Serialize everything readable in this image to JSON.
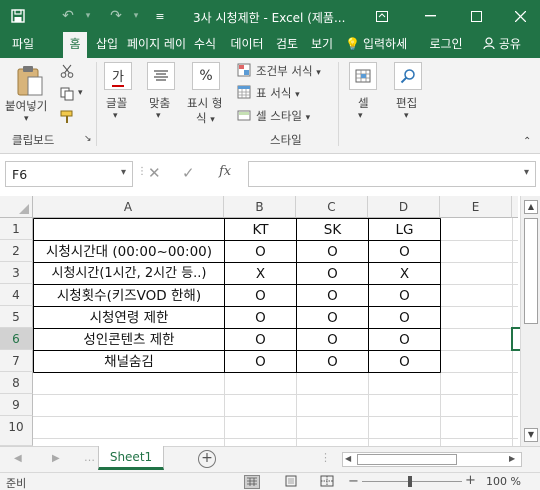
{
  "window": {
    "title": "3사 시청제한 - Excel (제품...",
    "accent": "#217346"
  },
  "tabs": [
    {
      "label": "파일",
      "active": false
    },
    {
      "label": "홈",
      "active": true
    },
    {
      "label": "삽입",
      "active": false
    },
    {
      "label": "페이지 레이",
      "active": false
    },
    {
      "label": "수식",
      "active": false
    },
    {
      "label": "데이터",
      "active": false
    },
    {
      "label": "검토",
      "active": false
    },
    {
      "label": "보기",
      "active": false
    }
  ],
  "tell_me": "입력하세",
  "sign_in": "로그인",
  "share": "공유",
  "ribbon": {
    "paste": "붙여넣기",
    "clipboard_group": "클립보드",
    "font": "글꼴",
    "alignment": "맞춤",
    "number_line1": "표시 형",
    "number_line2": "식",
    "cond_format": "조건부 서식",
    "format_table": "표 서식",
    "cell_styles": "셀 스타일",
    "styles_group": "스타일",
    "cells": "셀",
    "editing": "편집",
    "font_icon_glyph": "가",
    "number_icon_glyph": "%"
  },
  "formula_bar": {
    "name_box": "F6",
    "fx": "fx",
    "content": ""
  },
  "grid": {
    "columns": [
      "A",
      "B",
      "C",
      "D",
      "E"
    ],
    "row_numbers": [
      "1",
      "2",
      "3",
      "4",
      "5",
      "6",
      "7",
      "8",
      "9",
      "10"
    ],
    "rows": [
      [
        "",
        "KT",
        "SK",
        "LG"
      ],
      [
        "시청시간대 (00:00~00:00)",
        "O",
        "O",
        "O"
      ],
      [
        "시청시간(1시간, 2시간 등..)",
        "X",
        "O",
        "X"
      ],
      [
        "시청횟수(키즈VOD 한해)",
        "O",
        "O",
        "O"
      ],
      [
        "시청연령 제한",
        "O",
        "O",
        "O"
      ],
      [
        "성인콘텐츠 제한",
        "O",
        "O",
        "O"
      ],
      [
        "채널숨김",
        "O",
        "O",
        "O"
      ]
    ],
    "selected_cell": "F6"
  },
  "sheets": [
    {
      "name": "Sheet1",
      "active": true
    }
  ],
  "status": {
    "ready": "준비",
    "zoom": "100 %"
  }
}
